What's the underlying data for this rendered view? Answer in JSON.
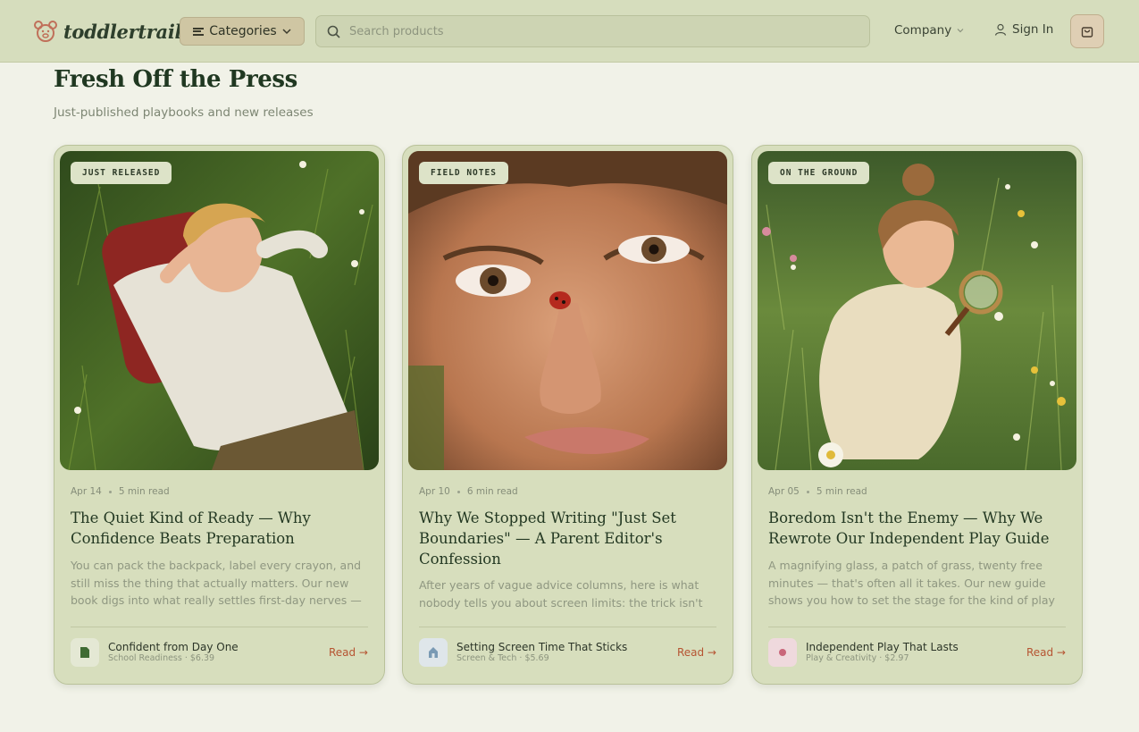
{
  "header": {
    "brand": "toddlertrail",
    "categories_label": "Categories",
    "search_placeholder": "Search products",
    "company_label": "Company",
    "signin_label": "Sign In"
  },
  "section": {
    "title": "Fresh Off the Press",
    "subtitle": "Just-published playbooks and new releases"
  },
  "colors": {
    "accent": "#b65432",
    "heading": "#203821",
    "header_bg": "#d6ddbd",
    "card_bg": "#d7debd"
  },
  "cards": [
    {
      "tag": "JUST RELEASED",
      "date": "Apr 14",
      "read_time": "5 min read",
      "title": "The Quiet Kind of Ready — Why Confidence Beats Preparation",
      "excerpt": "You can pack the backpack, label every crayon, and still miss the thing that actually matters. Our new book digs into what really settles first-day nerves — and it isn't the",
      "product_name": "Confident from Day One",
      "product_meta": "School Readiness · $6.39",
      "product_icon": "book-icon",
      "read_label": "Read →"
    },
    {
      "tag": "FIELD NOTES",
      "date": "Apr 10",
      "read_time": "6 min read",
      "title": "Why We Stopped Writing \"Just Set Boundaries\" — A Parent Editor's Confession",
      "excerpt": "After years of vague advice columns, here is what nobody tells you about screen limits: the trick isn't the...",
      "product_name": "Setting Screen Time That Sticks",
      "product_meta": "Screen & Tech · $5.69",
      "product_icon": "house-icon",
      "read_label": "Read →"
    },
    {
      "tag": "ON THE GROUND",
      "date": "Apr 05",
      "read_time": "5 min read",
      "title": "Boredom Isn't the Enemy — Why We Rewrote Our Independent Play Guide",
      "excerpt": "A magnifying glass, a patch of grass, twenty free minutes — that's often all it takes. Our new guide shows you how to set the stage for the kind of play kids don't",
      "product_name": "Independent Play That Lasts",
      "product_meta": "Play & Creativity · $2.97",
      "product_icon": "dot-icon",
      "read_label": "Read →"
    }
  ]
}
